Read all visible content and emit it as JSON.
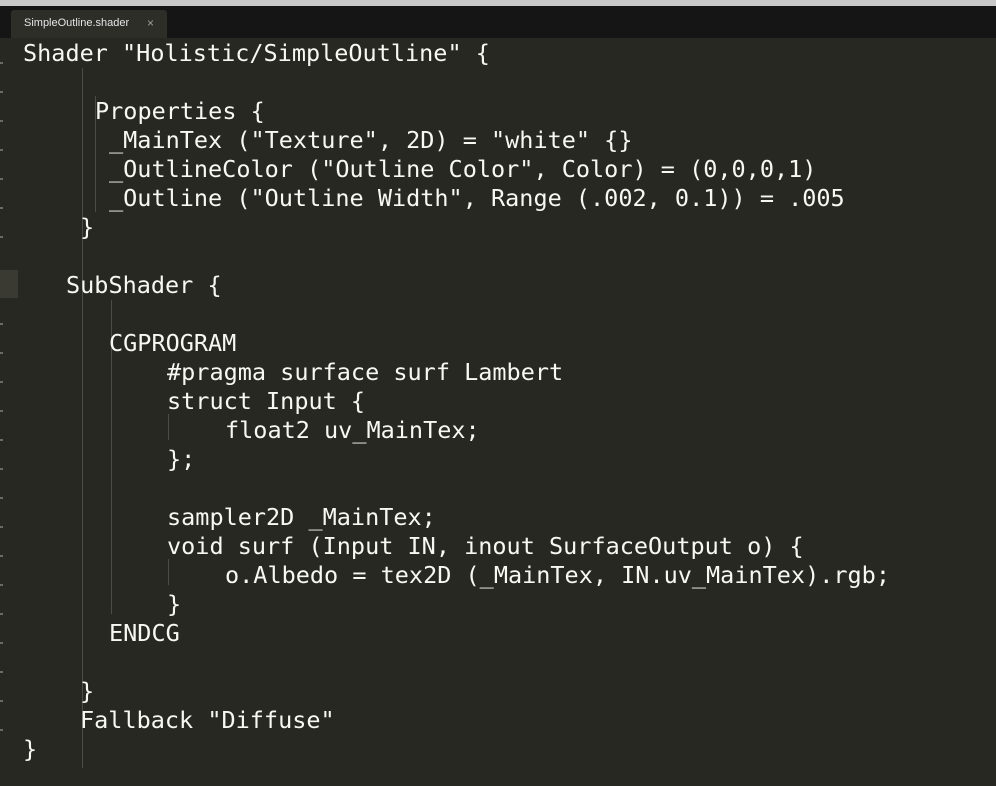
{
  "tab": {
    "filename": "SimpleOutline.shader",
    "close_glyph": "×"
  },
  "code": {
    "lines": [
      "Shader \"Holistic/SimpleOutline\" {",
      "",
      "Properties {",
      "_MainTex (\"Texture\", 2D) = \"white\" {}",
      "_OutlineColor (\"Outline Color\", Color) = (0,0,0,1)",
      "_Outline (\"Outline Width\", Range (.002, 0.1)) = .005",
      "}",
      "",
      "SubShader {",
      "",
      "CGPROGRAM",
      "#pragma surface surf Lambert",
      "struct Input {",
      "float2 uv_MainTex;",
      "};",
      "",
      "sampler2D _MainTex;",
      "void surf (Input IN, inout SurfaceOutput o) {",
      "o.Albedo = tex2D (_MainTex, IN.uv_MainTex).rgb;",
      "}",
      "ENDCG",
      "",
      "}",
      "Fallback \"Diffuse\"",
      "}"
    ]
  }
}
